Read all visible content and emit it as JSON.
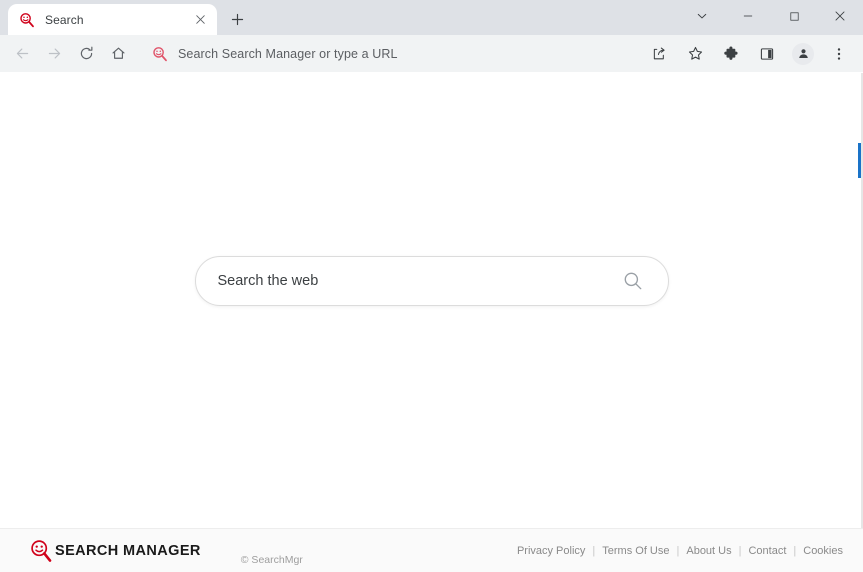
{
  "browser": {
    "tabs": [
      {
        "title": "Search",
        "favicon": "search-manager-favicon",
        "close_label": "×"
      }
    ],
    "new_tab_label": "+",
    "window_controls": {
      "search_tabs_label": "⌵",
      "minimize_label": "—",
      "maximize_label": "□",
      "close_label": "✕"
    },
    "navigation": {
      "back_label": "←",
      "forward_label": "→",
      "reload_label": "↻",
      "home_label": "⌂"
    },
    "omnibox": {
      "text": "Search Search Manager or type a URL",
      "icon": "search-manager-favicon"
    },
    "toolbar_icons": [
      {
        "name": "share-icon"
      },
      {
        "name": "bookmark-star-icon"
      },
      {
        "name": "extensions-puzzle-icon"
      },
      {
        "name": "side-panel-icon"
      },
      {
        "name": "profile-avatar-icon"
      },
      {
        "name": "three-dot-menu-icon"
      }
    ]
  },
  "page": {
    "search": {
      "placeholder": "Search the web",
      "value": "",
      "button_icon": "search-icon"
    },
    "footer": {
      "brand_name": "SEARCH MANAGER",
      "brand_icon": "search-manager-logo",
      "copyright": "© SearchMgr",
      "links": [
        {
          "label": "Privacy Policy"
        },
        {
          "label": "Terms Of Use"
        },
        {
          "label": "About Us"
        },
        {
          "label": "Contact"
        },
        {
          "label": "Cookies"
        }
      ],
      "separator": "|"
    }
  },
  "colors": {
    "brand_red": "#d0021b",
    "tabstrip_bg": "#dee1e6",
    "toolbar_bg": "#f1f3f4",
    "footer_bg": "#fafafa",
    "accent_blue": "#1a73c8"
  }
}
